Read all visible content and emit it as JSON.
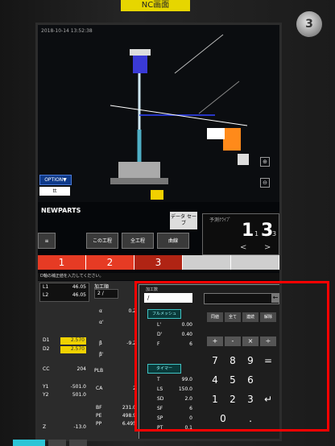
{
  "bezel": {
    "top_label": "NC画面",
    "knob_label": "3"
  },
  "sim": {
    "status_text": "2018-10-14 13:52:38",
    "option_label": "OPTION▼",
    "tt_label": "tt",
    "zoom_in": "⊕",
    "zoom_out": "⊖"
  },
  "program": {
    "name": "NEWPARTS",
    "data_button": "データ\nセーブ",
    "small_label": "予測ｸﾗｲﾌﾟ",
    "counter_a": "1",
    "counter_a_sub": "1",
    "counter_b": "3",
    "counter_b_sub": "3",
    "arrow_left": "<",
    "arrow_right": ">"
  },
  "tools": {
    "tool_icon": "≡",
    "current": "この工程",
    "all": "全工程",
    "stats": "曲線"
  },
  "steps": [
    {
      "label": "1"
    },
    {
      "label": "2"
    },
    {
      "label": "3"
    },
    {
      "label": ""
    },
    {
      "label": ""
    }
  ],
  "message": "D軸の補正値を入力してください。",
  "data": {
    "L1": {
      "label": "L1",
      "value": "46.05"
    },
    "L2": {
      "label": "L2",
      "value": "46.05"
    },
    "D1": {
      "label": "D1",
      "value": "2.570"
    },
    "D2": {
      "label": "D2",
      "value": "2.570"
    },
    "CC": {
      "label": "CC",
      "value": "204"
    },
    "Y1": {
      "label": "Y1",
      "value": "-501.0"
    },
    "Y2": {
      "label": "Y2",
      "value": "501.0"
    },
    "Z": {
      "label": "Z",
      "value": "-13.0"
    },
    "program_label": "加工順",
    "program_value": "2 /",
    "alpha": {
      "label": "α",
      "value": "0.2"
    },
    "alpha2": {
      "label": "α'",
      "value": ""
    },
    "beta": {
      "label": "β",
      "value": "-9.2"
    },
    "beta2": {
      "label": "β'",
      "value": ""
    },
    "plb": {
      "label": "PLB",
      "value": ""
    },
    "ca": {
      "label": "CA",
      "value": "2"
    },
    "bf": {
      "label": "BF",
      "value": "231.0"
    },
    "pe": {
      "label": "PE",
      "value": "498.9"
    },
    "pp": {
      "label": "PP",
      "value": "6.495"
    }
  },
  "popup": {
    "title": "加工数",
    "input_value": "/",
    "back": "←",
    "btn_full": "フルメッシュ",
    "btn_timer": "タイマー",
    "fields": [
      {
        "label": "L'",
        "value": "0.00"
      },
      {
        "label": "D'",
        "value": "0.40"
      },
      {
        "label": "F",
        "value": "6"
      },
      {
        "label": "T",
        "value": "99.0"
      },
      {
        "label": "LS",
        "value": "150.0"
      },
      {
        "label": "SD",
        "value": "2.0"
      },
      {
        "label": "SF",
        "value": "6"
      },
      {
        "label": "SP",
        "value": "0"
      },
      {
        "label": "PT",
        "value": "0.1"
      }
    ],
    "fn": [
      "同値",
      "全て",
      "連続",
      "解除"
    ],
    "ops": [
      "+",
      "-",
      "×",
      "÷"
    ],
    "keys": [
      "7",
      "8",
      "9",
      "=",
      "4",
      "5",
      "6",
      "",
      "1",
      "2",
      "3",
      "↵",
      "0",
      "",
      ".",
      ""
    ]
  }
}
